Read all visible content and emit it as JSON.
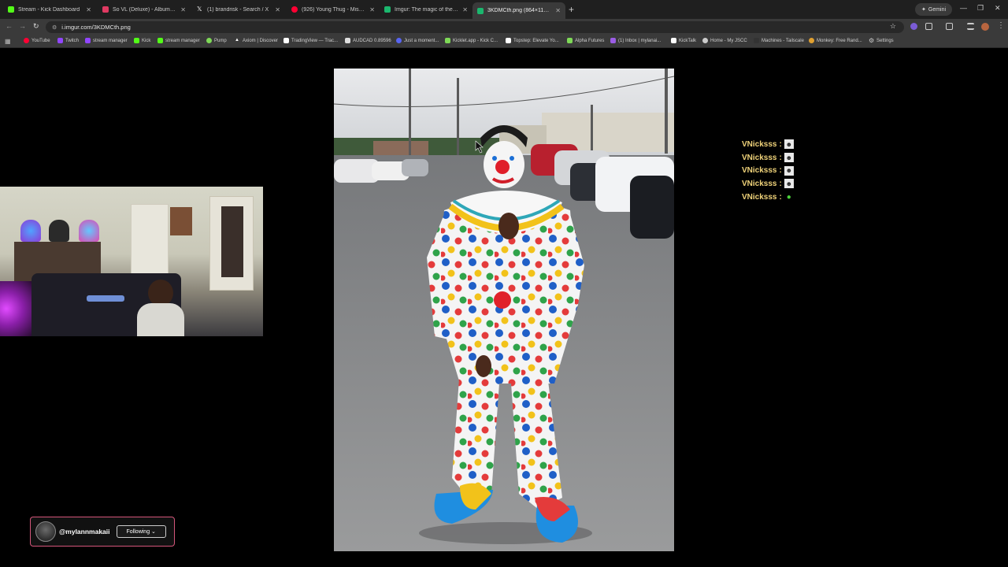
{
  "browser": {
    "tabs": [
      {
        "title": "Stream - Kick Dashboard",
        "color": "#53fc18"
      },
      {
        "title": "So VL (Deluxe) - Album by",
        "color": "#e03a62"
      },
      {
        "title": "(1) brandrisk - Search / X",
        "color": "#ffffff"
      },
      {
        "title": "(926) Young Thug - Miss M",
        "color": "#ff0033"
      },
      {
        "title": "Imgur: The magic of the intern",
        "color": "#1bb76e"
      },
      {
        "title": "3KDMCth.png (864×1184)",
        "color": "#1bb76e"
      }
    ],
    "new_tab": "+",
    "gemini": "Gemini",
    "url": "i.imgur.com/3KDMCth.png",
    "bookmarks": [
      {
        "label": "YouTube",
        "color": "#ff0033"
      },
      {
        "label": "Twitch",
        "color": "#9146ff"
      },
      {
        "label": "stream manager",
        "color": "#9146ff"
      },
      {
        "label": "Kick",
        "color": "#53fc18"
      },
      {
        "label": "stream manager",
        "color": "#53fc18"
      },
      {
        "label": "Pump",
        "color": "#7ed957"
      },
      {
        "label": "Axiom | Discover",
        "color": "#ffffff"
      },
      {
        "label": "TradingView — Trac...",
        "color": "#ffffff"
      },
      {
        "label": "AUDCAD 0.89596",
        "color": "#ffffff"
      },
      {
        "label": "Just a moment...",
        "color": "#5865f2"
      },
      {
        "label": "Kicklet.app - Kick C...",
        "color": "#7ed957"
      },
      {
        "label": "Topstep: Elevate Yo...",
        "color": "#ffffff"
      },
      {
        "label": "Alpha Futures",
        "color": "#7ed957"
      },
      {
        "label": "(1) Inbox | mylanai...",
        "color": "#9b5de5"
      },
      {
        "label": "KickTalk",
        "color": "#ffffff"
      },
      {
        "label": "Home - My JSCC",
        "color": "#cccccc"
      },
      {
        "label": "Machines - Tailscale",
        "color": "#333333"
      },
      {
        "label": "Monkey: Free Rand...",
        "color": "#e0a030"
      },
      {
        "label": "Settings",
        "color": "#cccccc"
      }
    ]
  },
  "chat": {
    "messages": [
      {
        "user": "VNicksss",
        "sep": ":",
        "emote": "person-emote"
      },
      {
        "user": "VNicksss",
        "sep": ":",
        "emote": "person-emote"
      },
      {
        "user": "VNicksss",
        "sep": ":",
        "emote": "person-emote"
      },
      {
        "user": "VNicksss",
        "sep": ":",
        "emote": "person-emote"
      },
      {
        "user": "VNicksss",
        "sep": ":",
        "emote": "green-emote"
      }
    ]
  },
  "follow": {
    "handle": "@mylannmakaii",
    "button": "Following ⌄"
  }
}
